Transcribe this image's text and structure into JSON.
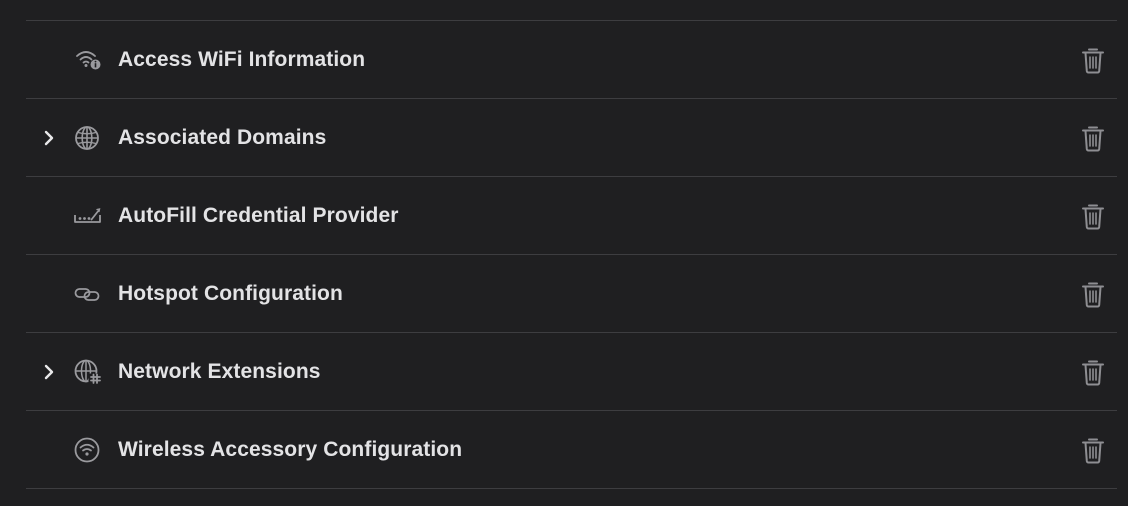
{
  "capabilities": [
    {
      "label": "Access WiFi Information",
      "icon": "wifi-info-icon",
      "expandable": false
    },
    {
      "label": "Associated Domains",
      "icon": "globe-icon",
      "expandable": true
    },
    {
      "label": "AutoFill Credential Provider",
      "icon": "password-field-icon",
      "expandable": false
    },
    {
      "label": "Hotspot Configuration",
      "icon": "link-icon",
      "expandable": false
    },
    {
      "label": "Network Extensions",
      "icon": "globe-network-icon",
      "expandable": true
    },
    {
      "label": "Wireless Accessory Configuration",
      "icon": "wifi-circle-icon",
      "expandable": false
    }
  ],
  "colors": {
    "background": "#1f1f21",
    "divider": "#3d3d40",
    "text": "#e3e3e5",
    "icon": "#9a9a9e"
  }
}
